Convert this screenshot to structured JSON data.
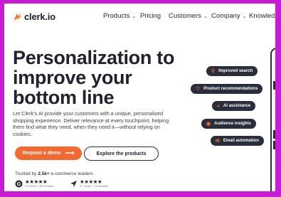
{
  "brand": {
    "name": "clerk.io",
    "accent": "#f26a31"
  },
  "nav": {
    "products": "Products",
    "pricing": "Pricing",
    "customers": "Customers",
    "company": "Company",
    "knowledge": "Knowledge"
  },
  "hero": {
    "title": "Personalization to improve your bottom line",
    "description": "Let Clerk's AI provide your customers with a unique, personalized shopping experience. Deliver relevance at every touchpoint, helping them find what they need, when they need it—without relying on cookies.",
    "cta_primary": "Request a demo",
    "cta_secondary": "Explore the products"
  },
  "trust": {
    "prefix": "Trusted by",
    "count": "2.5k+",
    "suffix": "e-commerce leaders",
    "ratings": [
      {
        "stars": "★★★★★",
        "sub": "4.8 score, +99 reviews"
      },
      {
        "stars": "★★★★★",
        "sub": "4.7 score, +15 reviews"
      }
    ]
  },
  "features": [
    {
      "label": "Improved search",
      "icon": "search-icon"
    },
    {
      "label": "Product recommendations",
      "icon": "heart-icon"
    },
    {
      "label": "AI assistance",
      "icon": "chevrons-icon"
    },
    {
      "label": "Audience insights",
      "icon": "insight-icon"
    },
    {
      "label": "Email automation",
      "icon": "mail-icon"
    }
  ]
}
